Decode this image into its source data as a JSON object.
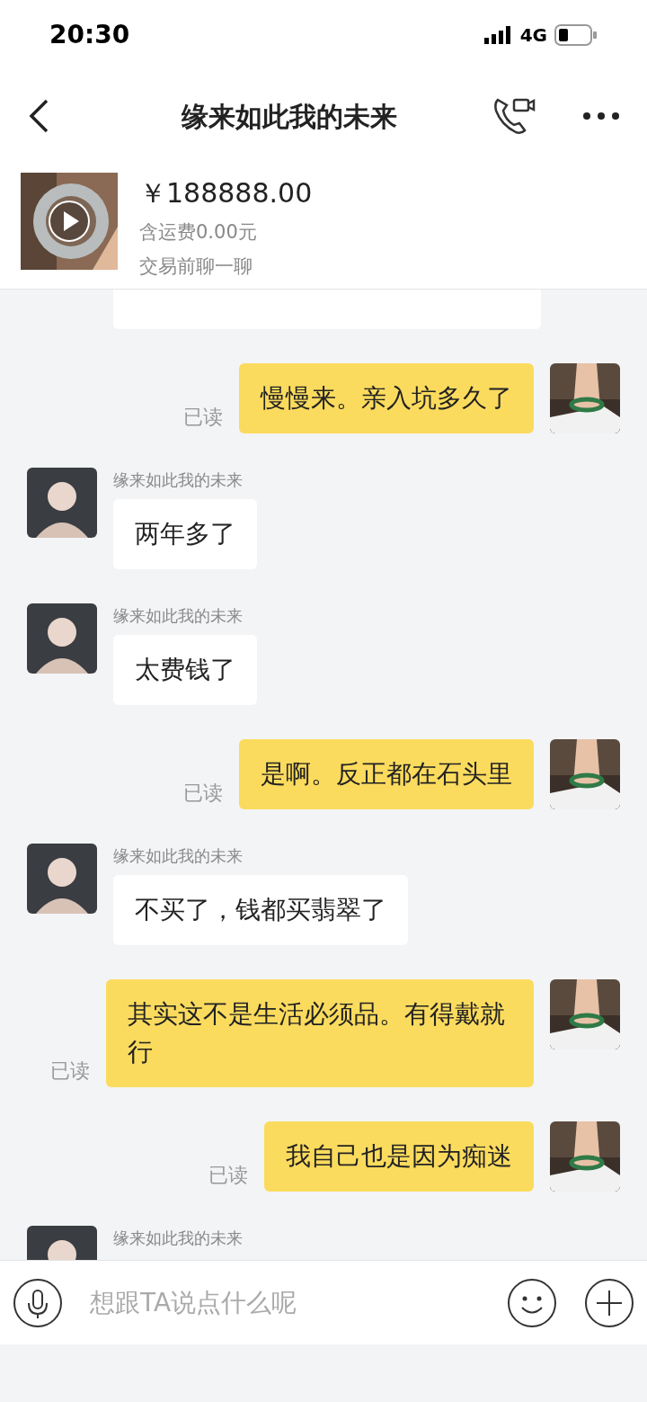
{
  "status_bar": {
    "time": "20:30",
    "network": "4G"
  },
  "header": {
    "title": "缘来如此我的未来"
  },
  "product": {
    "price": "￥188888.00",
    "shipping": "含运费0.00元",
    "note": "交易前聊一聊"
  },
  "messages": [
    {
      "kind": "in",
      "cut": true
    },
    {
      "kind": "out",
      "text": "慢慢来。亲入坑多久了",
      "status": "已读"
    },
    {
      "kind": "in",
      "sender": "缘来如此我的未来",
      "text": "两年多了"
    },
    {
      "kind": "in",
      "sender": "缘来如此我的未来",
      "text": "太费钱了"
    },
    {
      "kind": "out",
      "text": "是啊。反正都在石头里",
      "status": "已读"
    },
    {
      "kind": "in",
      "sender": "缘来如此我的未来",
      "text": "不买了，钱都买翡翠了"
    },
    {
      "kind": "out",
      "text": "其实这不是生活必须品。有得戴就行",
      "status": "已读"
    },
    {
      "kind": "out",
      "text": "我自己也是因为痴迷",
      "status": "已读"
    },
    {
      "kind": "in",
      "sender": "缘来如此我的未来"
    }
  ],
  "input": {
    "placeholder": "想跟TA说点什么呢"
  }
}
